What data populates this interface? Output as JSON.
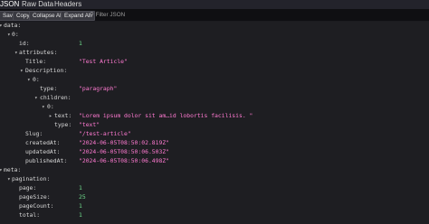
{
  "tabs": {
    "json": "JSON",
    "raw": "Raw Data",
    "headers": "Headers"
  },
  "toolbar": {
    "save": "Save",
    "copy": "Copy",
    "collapse_all": "Collapse All",
    "expand_all": "Expand All",
    "filter_placeholder": "Filter JSON"
  },
  "tree": {
    "data": "data:",
    "data_0": "0:",
    "id_key": "id:",
    "id_val": "1",
    "attributes": "attributes:",
    "title_key": "Title:",
    "title_val": "\"Test Article\"",
    "description": "Description:",
    "desc_0": "0:",
    "type_key": "type:",
    "type_val": "\"paragraph\"",
    "children": "children:",
    "child_0": "0:",
    "text_key": "text:",
    "text_val": "\"Lorem ipsum dolor sit am…id lobortis facilisis. \"",
    "text_type_key": "type:",
    "text_type_val": "\"text\"",
    "slug_key": "Slug:",
    "slug_val": "\"/test-article\"",
    "created_key": "createdAt:",
    "created_val": "\"2024-06-05T08:50:02.819Z\"",
    "updated_key": "updatedAt:",
    "updated_val": "\"2024-06-05T08:50:06.503Z\"",
    "published_key": "publishedAt:",
    "published_val": "\"2024-06-05T08:50:06.498Z\"",
    "meta": "meta:",
    "pagination": "pagination:",
    "page_key": "page:",
    "page_val": "1",
    "pagesize_key": "pageSize:",
    "pagesize_val": "25",
    "pagecount_key": "pageCount:",
    "pagecount_val": "1",
    "total_key": "total:",
    "total_val": "1"
  },
  "colors": {
    "number": "#6fdc8c",
    "string": "#ff7ad1",
    "accent": "#4aa3ff"
  },
  "icons": {
    "expanded": "triangle-down-icon",
    "collapsed": "triangle-right-icon",
    "filter": "filter-icon"
  }
}
